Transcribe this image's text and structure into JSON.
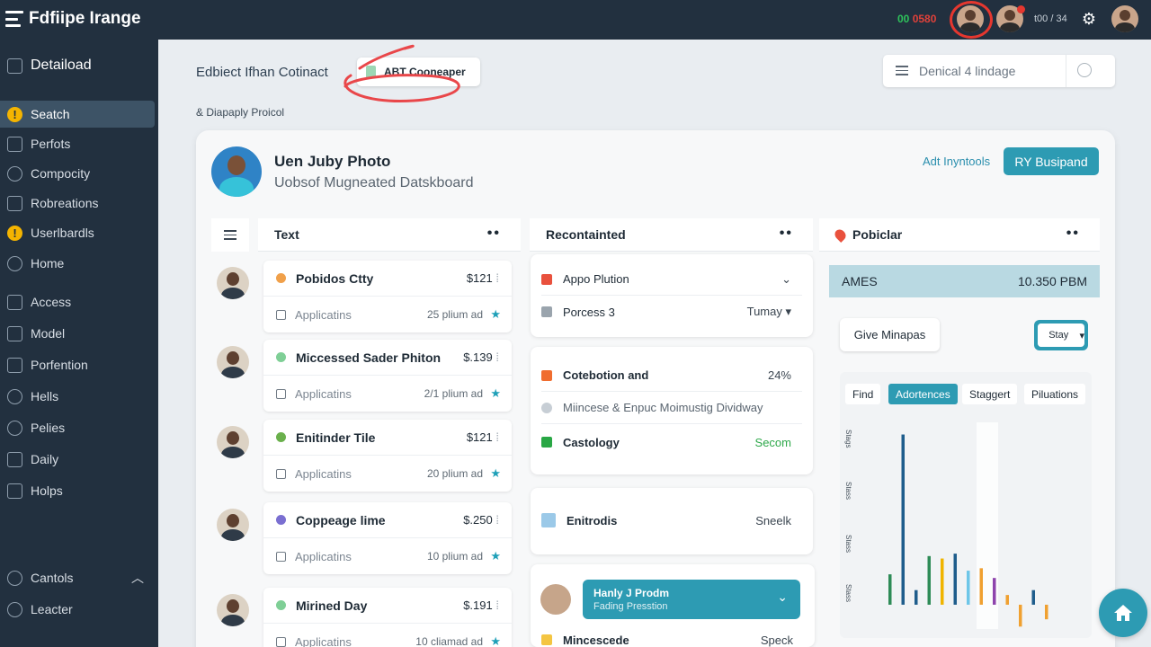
{
  "app": {
    "title": "Fdfiipe Irange"
  },
  "topbar": {
    "status_ok": "00",
    "status_alert": "0580",
    "count": "t00 / 34"
  },
  "sidebar": {
    "header": "Detaiload",
    "items": [
      {
        "label": "Seatch",
        "icon": "warning-icon",
        "active": true
      },
      {
        "label": "Perfots",
        "icon": "table-icon"
      },
      {
        "label": "Compocity",
        "icon": "person-icon"
      },
      {
        "label": "Robreations",
        "icon": "wrench-icon"
      },
      {
        "label": "Userlbardls",
        "icon": "warning-icon"
      },
      {
        "label": "Home",
        "icon": "target-icon"
      },
      {
        "label": "Access",
        "icon": "square-icon"
      },
      {
        "label": "Model",
        "icon": "grid-icon"
      },
      {
        "label": "Porfention",
        "icon": "grid-icon"
      },
      {
        "label": "Hells",
        "icon": "person-icon"
      },
      {
        "label": "Pelies",
        "icon": "person-icon"
      },
      {
        "label": "Daily",
        "icon": "list-icon"
      },
      {
        "label": "Holps",
        "icon": "phone-icon"
      }
    ],
    "footer": [
      {
        "label": "Cantols",
        "icon": "info-icon"
      },
      {
        "label": "Leacter",
        "icon": "link-icon"
      }
    ]
  },
  "header": {
    "title": "Edbiect Ifhan Cotinact",
    "button": "ABT Cooneaper",
    "crumb": "& Diapaply Proicol",
    "search_placeholder": "Denical 4 lindage"
  },
  "profile": {
    "name": "Uen Juby Photo",
    "subtitle": "Uobsof Mugneated Datskboard",
    "link": "Adt Inyntools",
    "primary": "RY Busipand"
  },
  "columns": {
    "list": "Text",
    "middle": "Recontainted",
    "right": "Pobiclar"
  },
  "rows": [
    {
      "title": "Pobidos Ctty",
      "price": "$121",
      "sub": "Applicatins",
      "meta": "25 plium ad",
      "color": "#f0a04a"
    },
    {
      "title": "Miccessed Sader Phiton",
      "price": "$.139",
      "sub": "Applicatins",
      "meta": "2/1 plium ad",
      "color": "#7fcf96"
    },
    {
      "title": "Enitinder Tile",
      "price": "$121",
      "sub": "Applicatins",
      "meta": "20 plium ad",
      "color": "#6ab04c"
    },
    {
      "title": "Coppeage lime",
      "price": "$.250",
      "sub": "Applicatins",
      "meta": "10 plium ad",
      "color": "#7a6fd1"
    },
    {
      "title": "Mirined Day",
      "price": "$.191",
      "sub": "Applicatins",
      "meta": "10 cliamad ad",
      "color": "#7fcf96"
    }
  ],
  "middle": {
    "card1": {
      "title": "Appo Plution",
      "line2": "Porcess 3",
      "line2_right": "Tumay"
    },
    "card2": {
      "line1": "Cotebotion and",
      "line1_right": "24%",
      "line2": "Miincese & Enpuc Moimustig Dividway",
      "line3": "Castology",
      "line3_right": "Secom"
    },
    "card3": {
      "title": "Enitrodis",
      "right": "Sneelk"
    },
    "card4": {
      "banner_title": "Hanly J Prodm",
      "banner_sub": "Fading Presstion",
      "line": "Mincescede",
      "line_right": "Speck"
    }
  },
  "right": {
    "ames_label": "AMES",
    "ames_value": "10.350 PBM",
    "give_button": "Give Minapas",
    "select_button": "Stay",
    "tabs": [
      {
        "label": "Find"
      },
      {
        "label": "Adortences",
        "active": true
      },
      {
        "label": "Staggert"
      },
      {
        "label": "Piluations"
      }
    ],
    "axis_labels": [
      "Stags",
      "Stass",
      "Stass",
      "Stass"
    ]
  },
  "chart_data": {
    "type": "bar",
    "title": "",
    "series": [
      {
        "values": [
          25,
          0,
          0,
          0,
          0,
          0,
          0,
          0,
          0,
          0,
          0,
          0,
          0,
          0,
          0,
          0
        ],
        "color": "#2e8b57"
      },
      {
        "values": [
          0,
          140,
          0,
          0,
          0,
          0,
          0,
          0,
          0,
          0,
          0,
          0,
          0,
          0,
          0,
          0
        ],
        "color": "#1f5d8c"
      },
      {
        "values": [
          0,
          0,
          12,
          0,
          0,
          0,
          0,
          0,
          0,
          0,
          0,
          0,
          0,
          0,
          0,
          0
        ],
        "color": "#1f5d8c"
      },
      {
        "values": [
          0,
          0,
          0,
          40,
          0,
          0,
          0,
          0,
          0,
          0,
          0,
          0,
          0,
          0,
          0,
          0
        ],
        "color": "#2e8b57"
      },
      {
        "values": [
          0,
          0,
          0,
          0,
          38,
          0,
          0,
          0,
          0,
          0,
          0,
          0,
          0,
          0,
          0,
          0
        ],
        "color": "#f0b400"
      },
      {
        "values": [
          0,
          0,
          0,
          0,
          0,
          42,
          0,
          0,
          0,
          0,
          0,
          0,
          0,
          0,
          0,
          0
        ],
        "color": "#1f5d8c"
      },
      {
        "values": [
          0,
          0,
          0,
          0,
          0,
          0,
          28,
          0,
          0,
          0,
          0,
          0,
          0,
          0,
          0,
          0
        ],
        "color": "#6ec6e8"
      },
      {
        "values": [
          0,
          0,
          0,
          0,
          0,
          0,
          0,
          30,
          0,
          0,
          0,
          0,
          0,
          0,
          0,
          0
        ],
        "color": "#f0a030"
      },
      {
        "values": [
          0,
          0,
          0,
          0,
          0,
          0,
          0,
          0,
          22,
          0,
          0,
          0,
          0,
          0,
          0,
          0
        ],
        "color": "#8e44ad"
      },
      {
        "values": [
          0,
          0,
          0,
          0,
          0,
          0,
          0,
          0,
          0,
          8,
          0,
          0,
          0,
          0,
          0,
          0
        ],
        "color": "#f0a030"
      },
      {
        "values": [
          0,
          0,
          0,
          0,
          0,
          0,
          0,
          0,
          0,
          0,
          -18,
          0,
          0,
          0,
          0,
          0
        ],
        "color": "#f0a030"
      },
      {
        "values": [
          0,
          0,
          0,
          0,
          0,
          0,
          0,
          0,
          0,
          0,
          0,
          12,
          0,
          0,
          0,
          0
        ],
        "color": "#1f5d8c"
      },
      {
        "values": [
          0,
          0,
          0,
          0,
          0,
          0,
          0,
          0,
          0,
          0,
          0,
          0,
          -12,
          0,
          0,
          0
        ],
        "color": "#f0a030"
      }
    ],
    "ylim": [
      -20,
      150
    ],
    "grid": false
  },
  "colors": {
    "sidebar": "#22303f",
    "accent": "#2d9bb3",
    "alert": "#e5372f"
  }
}
